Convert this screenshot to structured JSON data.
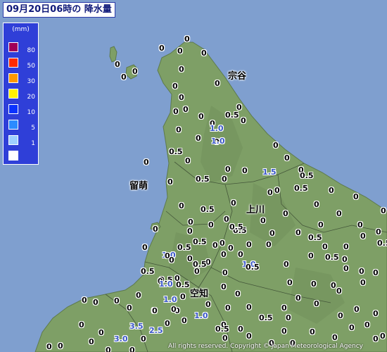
{
  "title": "09月20日06時の 降水量",
  "legend": {
    "unit": "(mm)",
    "levels": [
      {
        "label": "80",
        "color": "#a0005a"
      },
      {
        "label": "50",
        "color": "#ff2a00"
      },
      {
        "label": "30",
        "color": "#ff9900"
      },
      {
        "label": "20",
        "color": "#fff000"
      },
      {
        "label": "10",
        "color": "#0a32ff"
      },
      {
        "label": "5",
        "color": "#2b8bff"
      },
      {
        "label": "1",
        "color": "#9fd0ff"
      },
      {
        "label": "",
        "color": "#ffffff"
      }
    ]
  },
  "places": [
    {
      "name": "宗谷"
    },
    {
      "name": "留萌"
    },
    {
      "name": "上川"
    },
    {
      "name": "空知"
    }
  ],
  "observations": [
    "0",
    "0",
    "0",
    "0",
    "0",
    "0",
    "0",
    "0",
    "0",
    "0",
    "0",
    "0",
    "0",
    "0",
    "0",
    "0.5",
    "0",
    "1.0",
    "0",
    "0",
    "1.0",
    "0",
    "0",
    "0.5",
    "0",
    "0",
    "0",
    "0",
    "0",
    "0",
    "0",
    "1.5",
    "0.5",
    "0",
    "0.5",
    "0",
    "0.5",
    "0",
    "0",
    "0",
    "0",
    "0",
    "0",
    "0.5",
    "0",
    "0",
    "0",
    "0",
    "0",
    "0",
    "0",
    "0",
    "0",
    "0.5",
    "0",
    "0",
    "0",
    "0",
    "0",
    "0",
    "0.5",
    "0",
    "0",
    "0",
    "0",
    "0.5",
    "0.5",
    "1.0",
    "0",
    "0.5",
    "0",
    "0",
    "0",
    "0",
    "0.5",
    "0",
    "0",
    "0",
    "0",
    "0.5",
    "0",
    "1.0",
    "0",
    "0.5",
    "0",
    "0",
    "0",
    "0",
    "0",
    "0.5",
    "0",
    "0.5",
    "0.5",
    "0",
    "0",
    "0",
    "0",
    "0",
    "0",
    "0",
    "0",
    "0.5",
    "0",
    "1.0",
    "0",
    "0",
    "0",
    "0",
    "0",
    "0",
    "0",
    "0",
    "0",
    "1.0",
    "0",
    "0",
    "0",
    "0",
    "0",
    "0",
    "0",
    "0",
    "0",
    "0",
    "0",
    "1.0",
    "3.5",
    "2.5",
    "0",
    "0",
    "0",
    "0.5",
    "0",
    "0",
    "0",
    "0",
    "0",
    "3.0",
    "0",
    "0",
    "0",
    "0",
    "0",
    "0.5",
    "0",
    "0",
    "0",
    "0",
    "0",
    "0",
    "0",
    "0",
    "0",
    "0",
    "0",
    "0",
    "0",
    "0"
  ],
  "copyright": "All rights reserved. Copyright © Japan Meteorological Agency",
  "colors": {
    "sea": "#7f9fcf",
    "land": "#7e9f66",
    "land_dark": "#6f8f5a"
  }
}
